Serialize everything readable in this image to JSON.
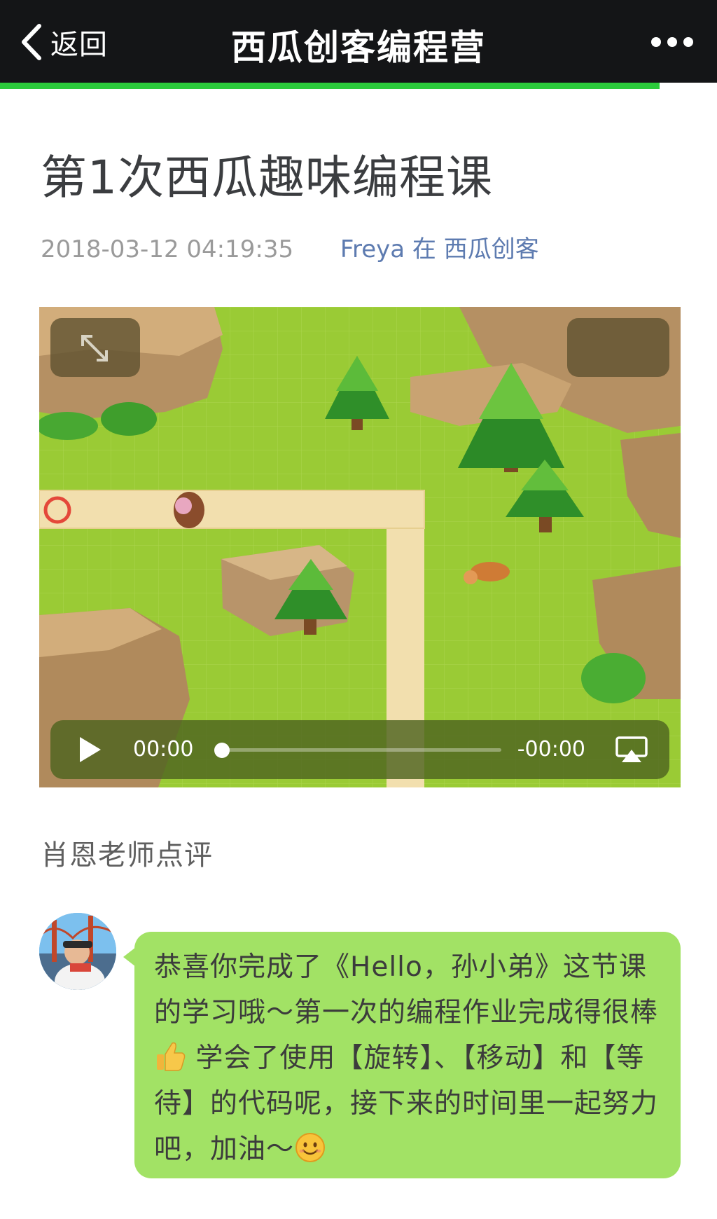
{
  "header": {
    "back_label": "返回",
    "title": "西瓜创客编程营",
    "menu_icon": "more-dots-icon",
    "load_progress": 0.92,
    "colors": {
      "bar": "#141517",
      "progress": "#2bcb3b"
    }
  },
  "article": {
    "title": "第1次西瓜趣味编程课",
    "timestamp": "2018-03-12 04:19:35",
    "author_line": "Freya 在 西瓜创客"
  },
  "video": {
    "current_time": "00:00",
    "remaining_time": "-00:00",
    "progress": 0,
    "controls": [
      "fullscreen-icon",
      "play-icon",
      "airplay-icon"
    ]
  },
  "comment": {
    "reviewer": "肖恩老师点评",
    "text_part1": "恭喜你完成了《Hello，孙小弟》这节课的学习哦～第一次的编程作业完成得很棒",
    "text_part2": " 学会了使用【旋转】、【移动】和【等待】的代码呢，接下来的时间里一起努力吧，加油～",
    "emojis": [
      "thumbs-up-icon",
      "smile-icon"
    ],
    "bubble_color": "#a2e265"
  }
}
